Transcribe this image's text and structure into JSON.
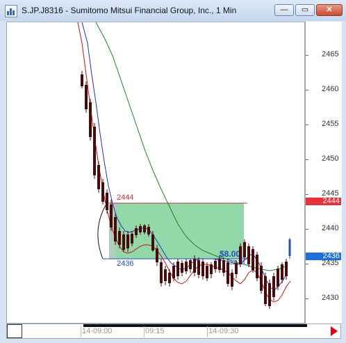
{
  "window": {
    "title": "S.JP.J8316 - Sumitomo Mitsui Financial Group, Inc., 1 Min",
    "buttons": {
      "minimize": "—",
      "restore": "▭",
      "close": "✕"
    }
  },
  "price_axis": {
    "ticks": [
      "2465",
      "2460",
      "2455",
      "2450",
      "2445",
      "2440",
      "2435",
      "2430"
    ],
    "markers": [
      {
        "label": "2444",
        "color": "#e8303a"
      },
      {
        "label": "2436",
        "color": "#1f6fd6"
      }
    ]
  },
  "time_axis": {
    "labels": [
      "14-09:00",
      "09:15",
      "14-09:30"
    ]
  },
  "chart": {
    "annotations": {
      "upper_label": "2444",
      "lower_label": "2436",
      "diff_label": "$8.00",
      "small_label": "32:28"
    },
    "colors": {
      "box_fill": "#7fd19a",
      "upper_line": "#c8303a",
      "lower_line": "#1f4fc0",
      "ma_red": "#cc1010",
      "ma_blue": "#2030c8",
      "ma_green": "#128a1a",
      "candle": "#4a0a0a"
    }
  },
  "chart_data": {
    "type": "candlestick",
    "timeframe": "1 Min",
    "ylim": [
      2428,
      2469
    ],
    "yticks": [
      2430,
      2435,
      2440,
      2445,
      2450,
      2455,
      2460,
      2465
    ],
    "xtick_labels": [
      "14-09:00",
      "09:15",
      "14-09:30"
    ],
    "horizontal_levels": [
      2444,
      2436
    ]
  }
}
